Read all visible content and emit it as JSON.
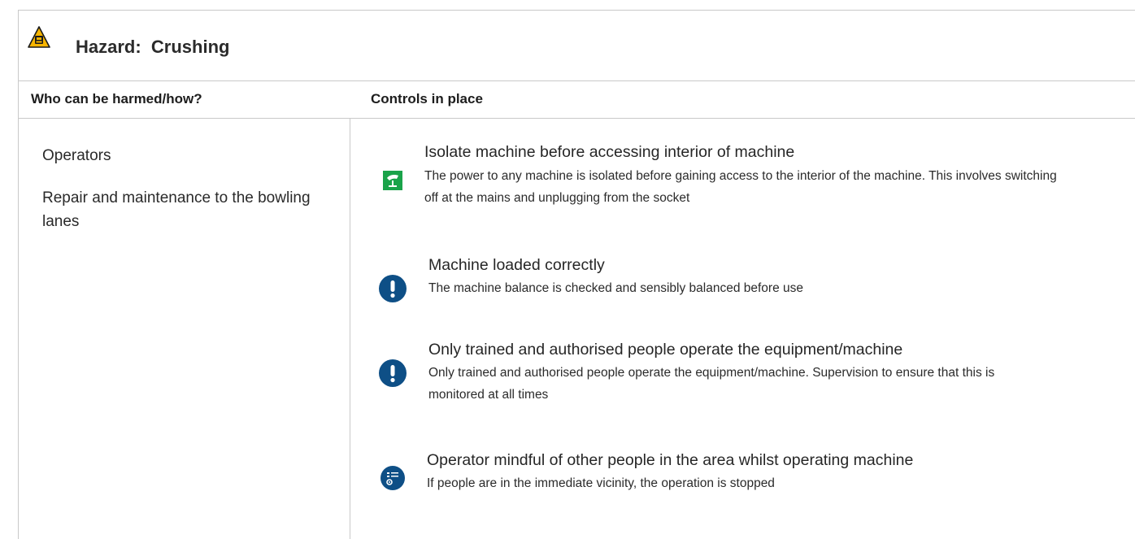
{
  "hazard": {
    "title": "Hazard:  Crushing",
    "icon": "hazard-warning-icon",
    "icon_color": "#f6b400"
  },
  "columns": {
    "who": "Who can be harmed/how?",
    "controls": "Controls in place"
  },
  "harmed": [
    "Operators",
    "Repair and maintenance to the bowling lanes"
  ],
  "controls": [
    {
      "icon": "isolate-power-icon",
      "icon_color": "#1aa34a",
      "title": "Isolate machine before accessing interior of machine",
      "description": "The power to any machine is isolated before gaining access to the interior of the machine. This involves switching off at the mains and unplugging from the socket"
    },
    {
      "icon": "exclamation-icon",
      "icon_color": "#0e4f86",
      "title": "Machine loaded correctly",
      "description": "The machine balance is checked and sensibly balanced before use"
    },
    {
      "icon": "exclamation-icon",
      "icon_color": "#0e4f86",
      "title": "Only trained and authorised people operate the equipment/machine",
      "description": "Only trained and authorised people operate the equipment/machine. Supervision to ensure that this is monitored at all times"
    },
    {
      "icon": "procedure-checklist-icon",
      "icon_color": "#0e4f86",
      "title": "Operator mindful of other people in the area whilst operating machine",
      "description": "If people are in the immediate vicinity, the operation is stopped"
    }
  ]
}
